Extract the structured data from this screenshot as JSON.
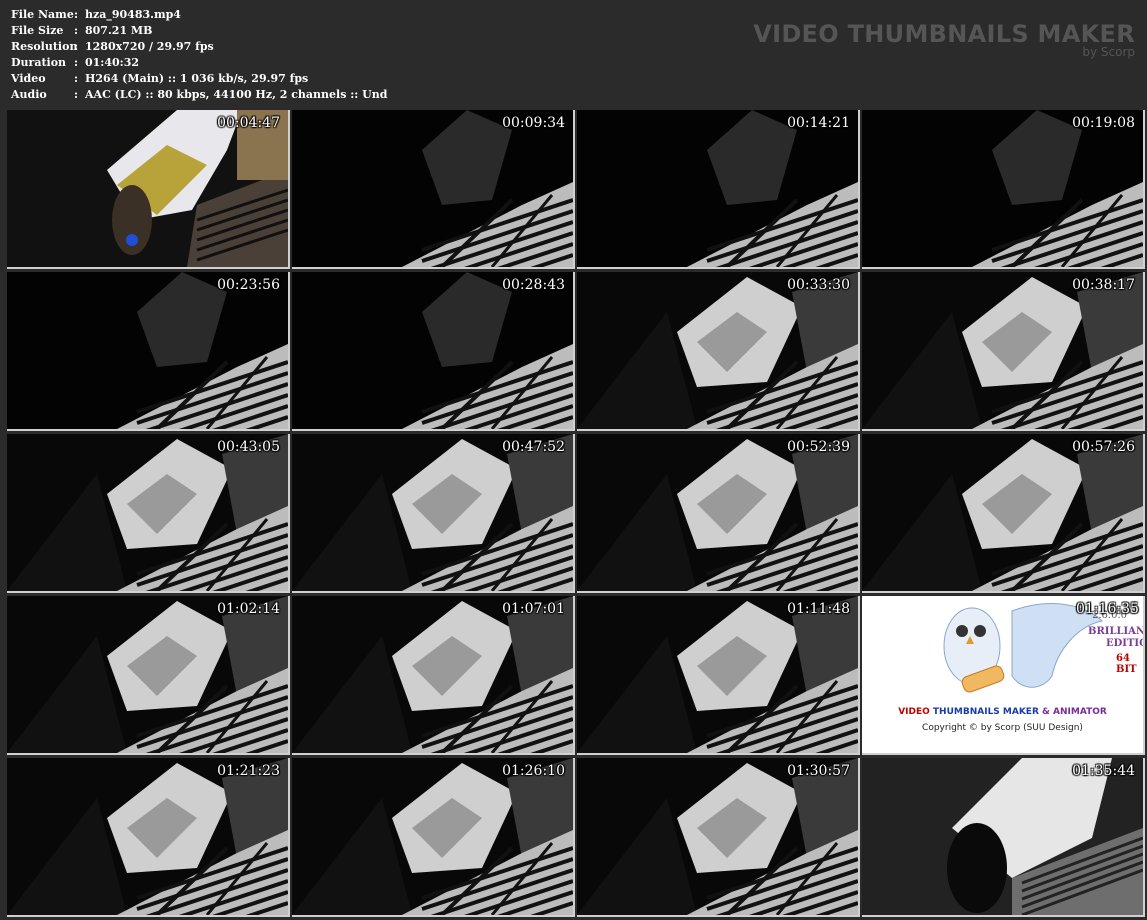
{
  "info": [
    {
      "label": "File Name",
      "value": "hza_90483.mp4"
    },
    {
      "label": "File Size",
      "value": "807.21 MB"
    },
    {
      "label": "Resolution",
      "value": "1280x720 / 29.97 fps"
    },
    {
      "label": "Duration",
      "value": "01:40:32"
    },
    {
      "label": "Video",
      "value": "H264 (Main) :: 1 036 kb/s, 29.97 fps"
    },
    {
      "label": "Audio",
      "value": "AAC (LC) :: 80 kbps, 44100 Hz, 2 channels :: Und"
    }
  ],
  "separator": ":",
  "brand": {
    "title": "VIDEO THUMBNAILS MAKER",
    "subtitle": "by Scorp"
  },
  "thumbs": [
    {
      "time": "00:04:47",
      "scene": "color"
    },
    {
      "time": "00:09:34",
      "scene": "dark"
    },
    {
      "time": "00:14:21",
      "scene": "dark"
    },
    {
      "time": "00:19:08",
      "scene": "dark"
    },
    {
      "time": "00:23:56",
      "scene": "dark"
    },
    {
      "time": "00:28:43",
      "scene": "dark"
    },
    {
      "time": "00:33:30",
      "scene": "bed"
    },
    {
      "time": "00:38:17",
      "scene": "bed"
    },
    {
      "time": "00:43:05",
      "scene": "bed"
    },
    {
      "time": "00:47:52",
      "scene": "bed"
    },
    {
      "time": "00:52:39",
      "scene": "bed"
    },
    {
      "time": "00:57:26",
      "scene": "bed"
    },
    {
      "time": "01:02:14",
      "scene": "bed"
    },
    {
      "time": "01:07:01",
      "scene": "bed"
    },
    {
      "time": "01:11:48",
      "scene": "bed"
    },
    {
      "time": "01:16:35",
      "scene": "promo"
    },
    {
      "time": "01:21:23",
      "scene": "bed"
    },
    {
      "time": "01:26:10",
      "scene": "bed"
    },
    {
      "time": "01:30:57",
      "scene": "bed"
    },
    {
      "time": "01:35:44",
      "scene": "bright"
    }
  ],
  "promo": {
    "version": "2.6.0.0",
    "edition_line1": "BRILLIANT",
    "edition_line2": "EDITION",
    "bits": "64 BIT",
    "title_part1": "VIDEO",
    "title_part2": "THUMBNAILS MAKER",
    "title_part3": "& ANIMATOR",
    "copyright": "Copyright © by Scorp (SUU Design)"
  },
  "colors": {
    "background": "#2b2b2b",
    "brand_text": "#555555",
    "thumb_border": "#d0d0d0"
  }
}
